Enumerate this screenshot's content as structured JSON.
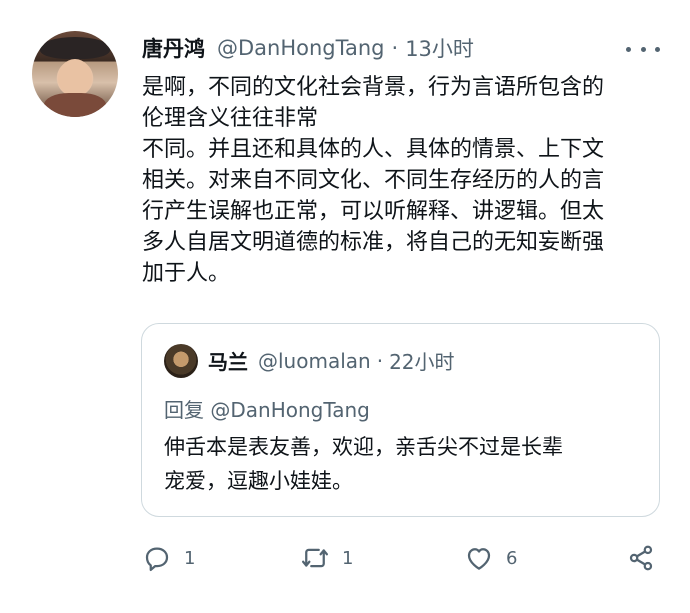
{
  "tweet": {
    "name": "唐丹鸿",
    "handle": "@DanHongTang",
    "separator": "·",
    "time": "13小时",
    "lines": [
      "是啊，不同的文化社会背景，行为言语所包含的",
      "伦理含义往往非常",
      "不同。并且还和具体的人、具体的情景、上下文",
      "相关。对来自不同文化、不同生存经历的人的言",
      "行产生误解也正常，可以听解释、讲逻辑。但太",
      "多人自居文明道德的标准，将自己的无知妄断强",
      "加于人。"
    ]
  },
  "quote": {
    "name": "马兰",
    "handle": "@luomalan",
    "separator": "·",
    "time": "22小时",
    "reply_to": "回复 @DanHongTang",
    "lines": [
      "伸舌本是表友善，欢迎，亲舌尖不过是长辈",
      "宠爱，逗趣小娃娃。"
    ]
  },
  "actions": {
    "reply_count": "1",
    "retweet_count": "1",
    "like_count": "6"
  },
  "colors": {
    "text": "#0f1419",
    "secondary": "#536471",
    "border": "#cfd9de"
  },
  "icons": [
    "more-icon",
    "reply-icon",
    "retweet-icon",
    "like-icon",
    "share-icon"
  ]
}
